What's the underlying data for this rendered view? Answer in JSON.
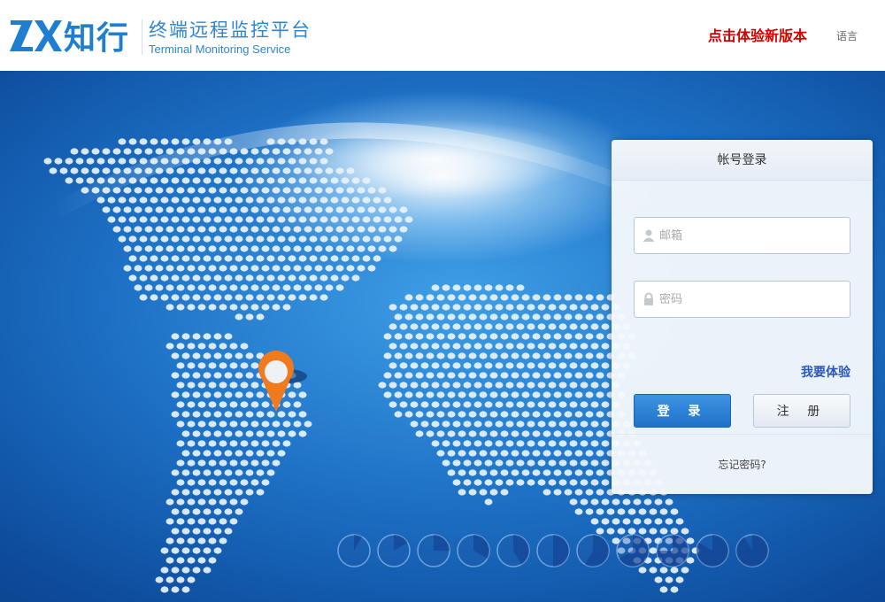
{
  "header": {
    "logo_mark": "ZX",
    "logo_cn": "知行",
    "title": "终端远程监控平台",
    "subtitle": "Terminal Monitoring Service",
    "new_version_link": "点击体验新版本",
    "language_link": "语言"
  },
  "login": {
    "panel_title": "帐号登录",
    "email_placeholder": "邮箱",
    "password_placeholder": "密码",
    "trial_link": "我要体验",
    "login_button": "登 录",
    "register_button": "注 册",
    "forgot_link": "忘记密码?"
  },
  "colors": {
    "brand_blue": "#1e7fd2",
    "new_version_red": "#d40000",
    "login_button": "#1f72c9",
    "trial_link": "#2a57b8",
    "pin_orange": "#f07a1e"
  },
  "icons": {
    "email_field": "user-icon",
    "password_field": "lock-icon",
    "map_marker": "location-pin-icon"
  }
}
